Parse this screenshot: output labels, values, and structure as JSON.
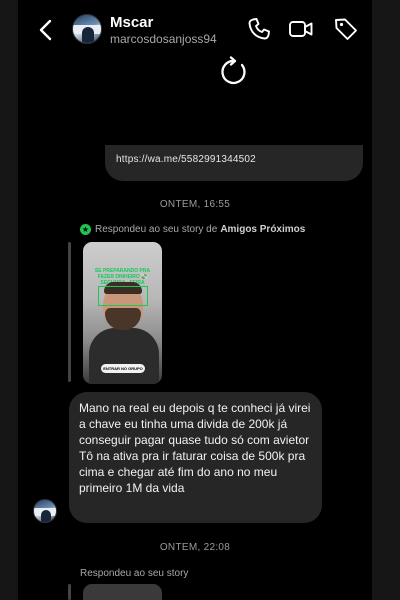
{
  "header": {
    "title": "Mscar",
    "username": "marcosdosanjoss94",
    "icons": [
      "back-icon",
      "phone-icon",
      "video-icon",
      "tag-icon"
    ]
  },
  "messages": {
    "link_text": "https://wa.me/5582991344502",
    "timestamp_1": "ONTEM, 16:55",
    "story_reply_prefix": "Respondeu ao seu story de",
    "story_reply_audience": "Amigos Próximos",
    "story_header_text": "SE PREPARANDO PRA FAZER DINHEIRO 💸 SEGUNDA - FEIRA",
    "story_button_text": "ENTRAR NO GRUPO",
    "message_line_1": "Mano na real eu depois q te conheci já virei a chave eu tinha uma divida de 200k já conseguir pagar quase tudo só com avietor",
    "message_line_2": "Tô na ativa pra ir faturar coisa de 500k pra cima e chegar até fim do ano no meu primeiro 1M da vida",
    "timestamp_2": "ONTEM, 22:08",
    "story_reply_2": "Respondeu ao seu story"
  },
  "colors": {
    "background": "#000000",
    "bubble": "#262626",
    "accent_green": "#21c553",
    "muted_text": "#a8a8a8"
  }
}
